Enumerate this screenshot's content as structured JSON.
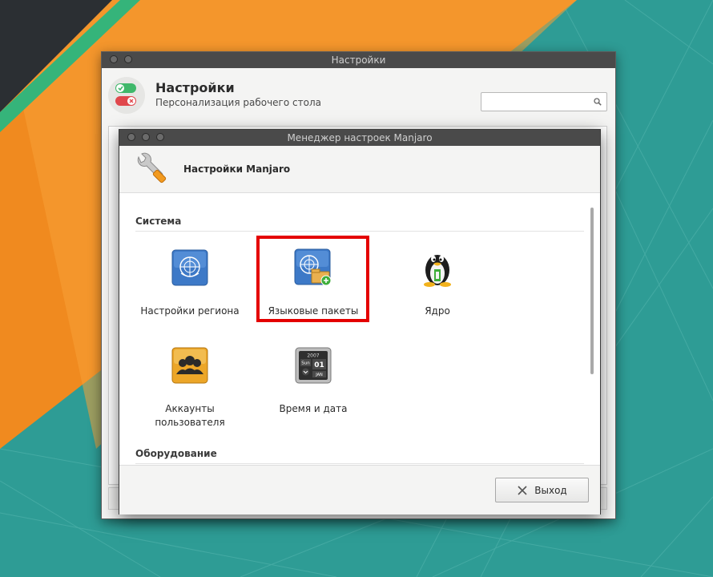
{
  "desktop": {
    "colors": {
      "teal": "#2e9c95",
      "orange": "#f38e1f",
      "dark": "#2b2f33",
      "green": "#35b47a"
    }
  },
  "back_window": {
    "title": "Настройки",
    "header_title": "Настройки",
    "header_subtitle": "Персонализация рабочего стола",
    "search": {
      "value": "",
      "placeholder": "",
      "icon": "search-icon"
    }
  },
  "front_window": {
    "title": "Менеджер настроек Manjaro",
    "header_title": "Настройки Manjaro",
    "app_icon": "wrench-icon",
    "sections": [
      {
        "title": "Система",
        "items": [
          {
            "label": "Настройки региона",
            "icon": "globe-icon"
          },
          {
            "label": "Языковые пакеты",
            "icon": "language-packages-icon"
          },
          {
            "label": "Ядро",
            "icon": "tux-icon"
          },
          {
            "label": "Аккаунты пользователя",
            "icon": "users-icon"
          },
          {
            "label": "Время и дата",
            "icon": "calendar-icon",
            "calendar": {
              "year": "2007",
              "day_name": "Sun",
              "day": "01",
              "month": "JAN"
            }
          }
        ]
      },
      {
        "title": "Оборудование",
        "items": []
      }
    ],
    "selected_item": "Языковые пакеты",
    "highlight_color": "#e40000",
    "exit_button": {
      "label": "Выход",
      "icon": "close-icon"
    }
  }
}
